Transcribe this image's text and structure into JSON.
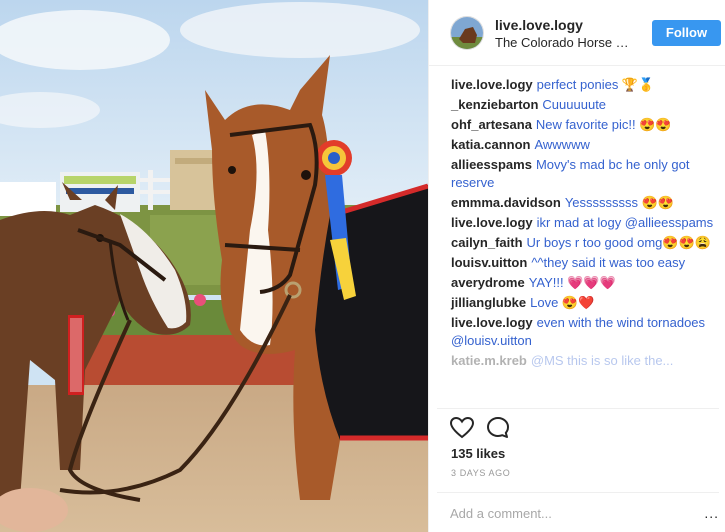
{
  "post": {
    "photo_alt": "",
    "header": {
      "username": "live.love.logy",
      "location": "The Colorado Horse Park",
      "follow_label": "Follow",
      "avatar_icon": "horse-avatar-icon"
    },
    "comments": [
      {
        "user": "live.love.logy",
        "text": "perfect ponies 🏆🥇"
      },
      {
        "user": "_kenziebarton",
        "text": "Cuuuuuute"
      },
      {
        "user": "ohf_artesana",
        "text": "New favorite pic!! 😍😍"
      },
      {
        "user": "katia.cannon",
        "text": "Awwwww"
      },
      {
        "user": "allieesspams",
        "text": "Movy's mad bc he only got reserve"
      },
      {
        "user": "emmma.davidson",
        "text": "Yesssssssss 😍😍"
      },
      {
        "user": "live.love.logy",
        "text": "ikr mad at logy @allieesspams"
      },
      {
        "user": "cailyn_faith",
        "text": "Ur boys r too good omg😍😍😩"
      },
      {
        "user": "louisv.uitton",
        "text": "^^they said it was too easy"
      },
      {
        "user": "averydrome",
        "text": "YAY!!! 💗💗💗"
      },
      {
        "user": "jillianglubke",
        "text": "Love 😍❤️"
      },
      {
        "user": "live.love.logy",
        "text": "even with the wind tornadoes @louisv.uitton"
      },
      {
        "user": "katie.m.kreb",
        "text": "@MS this is so like the..."
      }
    ],
    "actions": {
      "like_icon": "heart-icon",
      "comment_icon": "comment-bubble-icon"
    },
    "likes": "135 likes",
    "time_ago": "3 DAYS AGO",
    "add_comment": {
      "placeholder": "Add a comment...",
      "more_label": "..."
    }
  }
}
